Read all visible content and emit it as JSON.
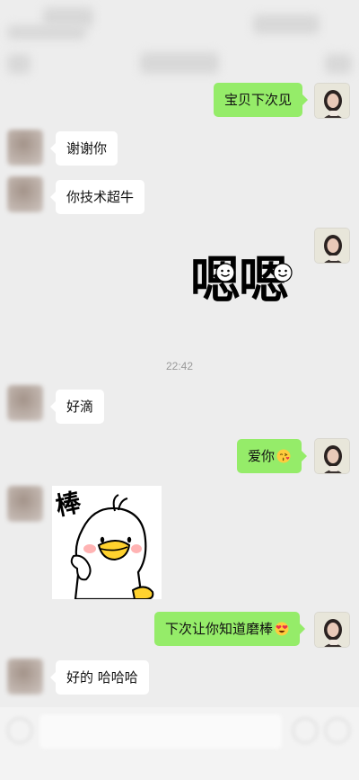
{
  "chat": {
    "messages": [
      {
        "side": "right",
        "text": "宝贝下次见"
      },
      {
        "side": "left",
        "text": "谢谢你"
      },
      {
        "side": "left",
        "text": "你技术超牛"
      },
      {
        "side": "right",
        "type": "sticker",
        "sticker_text": "嗯嗯"
      },
      {
        "side": "left",
        "text": "好滴"
      },
      {
        "side": "right",
        "text": "爱你",
        "emoji": "kiss-emoji"
      },
      {
        "side": "left",
        "type": "sticker",
        "sticker_text": "棒"
      },
      {
        "side": "right",
        "text": "下次让你知道磨棒",
        "emoji": "heart-eyes-emoji"
      },
      {
        "side": "left",
        "text": "好的 哈哈哈"
      }
    ],
    "timestamp": "22:42"
  },
  "colors": {
    "background": "#ededed",
    "bubble_self": "#95ec69",
    "bubble_other": "#ffffff",
    "timestamp": "#9a9a9a"
  }
}
